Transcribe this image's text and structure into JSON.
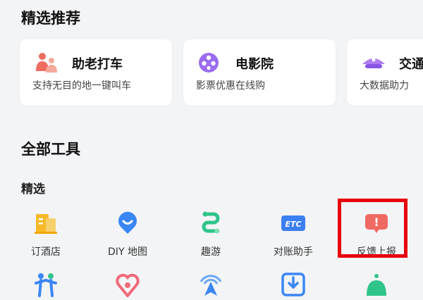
{
  "recommend": {
    "title": "精选推荐",
    "cards": [
      {
        "name": "助老打车",
        "desc": "支持无目的地一键叫车",
        "icon": "elderly-people-icon"
      },
      {
        "name": "电影院",
        "desc": "影票优惠在线购",
        "icon": "film-reel-icon"
      },
      {
        "name": "交通",
        "desc": "大数据助力",
        "icon": "traffic-police-cap-icon"
      }
    ]
  },
  "tools": {
    "title": "全部工具",
    "subtitle": "精选",
    "items": [
      {
        "label": "订酒店",
        "icon": "hotel-building-icon"
      },
      {
        "label": "DIY 地图",
        "icon": "map-pin-smile-icon"
      },
      {
        "label": "趣游",
        "icon": "route-path-icon"
      },
      {
        "label": "对账助手",
        "icon": "etc-card-icon",
        "badge": "ETC"
      },
      {
        "label": "反馈上报",
        "icon": "feedback-alert-icon",
        "badge": "!"
      }
    ],
    "row2_icons": [
      "people-running-icon",
      "heart-location-icon",
      "navigation-arrow-icon",
      "download-tray-icon",
      "bell-mountain-icon"
    ]
  },
  "colors": {
    "highlight": "#e8000d",
    "background": "#f3f4f6"
  }
}
